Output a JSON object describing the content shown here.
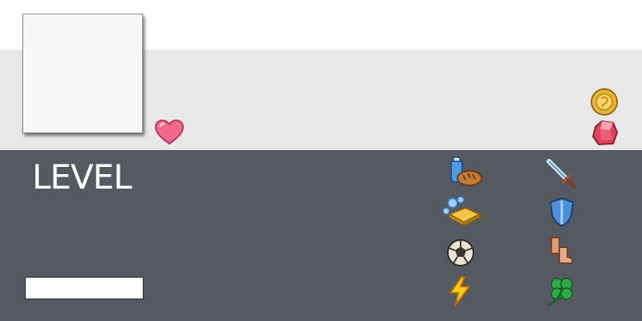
{
  "hud": {
    "level_label": "LEVEL",
    "name_field_value": ""
  },
  "icons": {
    "heart": "heart-icon",
    "coin": "coin-icon",
    "gem": "gem-icon",
    "potion_bread": "potion-bread-icon",
    "gold_bar": "gold-bar-icon",
    "ball": "ball-icon",
    "lightning": "lightning-icon",
    "sword": "sword-icon",
    "shield": "shield-icon",
    "boots": "boots-icon",
    "clover": "clover-icon"
  },
  "colors": {
    "panel_dark": "#555961",
    "panel_light": "#e8e8e8",
    "heart": "#f06a8c",
    "coin": "#e7b53a",
    "gem": "#e0435f",
    "lightning": "#ffcc1a",
    "clover": "#2fa84a"
  }
}
